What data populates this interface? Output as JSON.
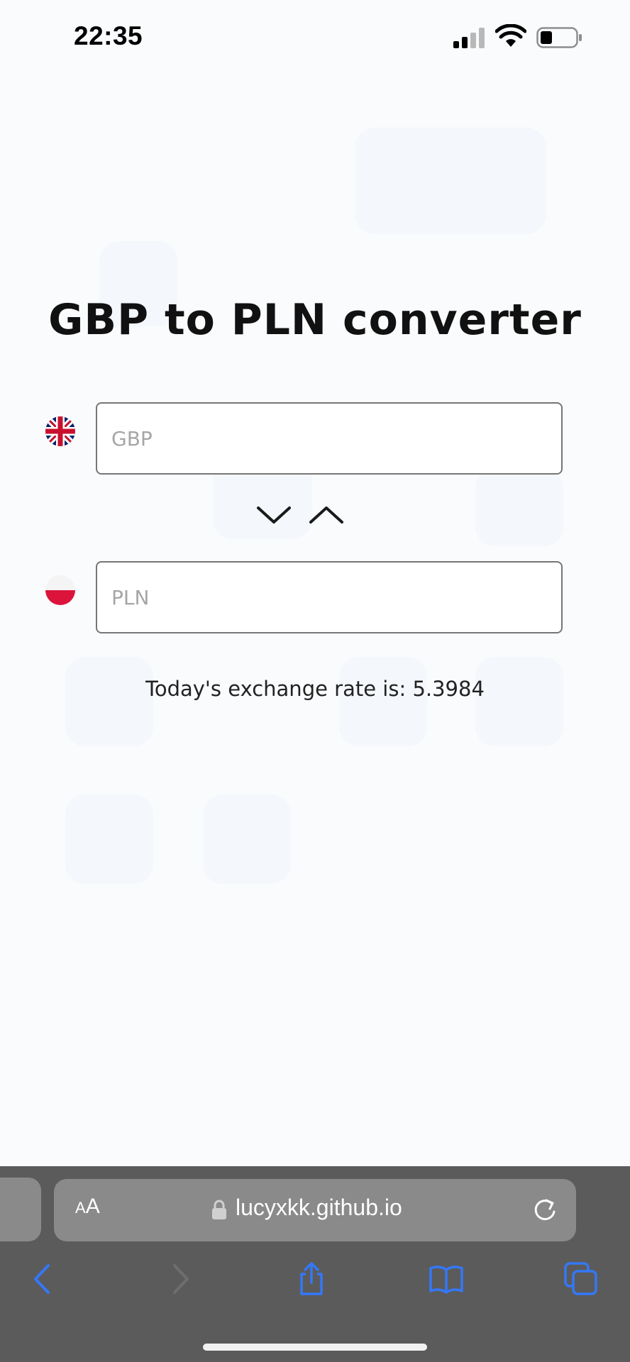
{
  "status_bar": {
    "time": "22:35",
    "icons": [
      "signal-icon",
      "wifi-icon",
      "battery-icon"
    ]
  },
  "converter": {
    "title": "GBP to PLN converter",
    "from": {
      "flag_icon": "uk-flag-icon",
      "value": "",
      "placeholder": "GBP"
    },
    "to": {
      "flag_icon": "poland-flag-icon",
      "value": "",
      "placeholder": "PLN"
    },
    "swap_icons": [
      "chevron-down-icon",
      "chevron-up-icon"
    ],
    "rate_text": "Today's exchange rate is: 5.3984"
  },
  "browser": {
    "text_size_small": "A",
    "text_size_large": "A",
    "url": "lucyxkk.github.io",
    "icons": [
      "lock-icon",
      "reload-icon",
      "back-icon",
      "forward-icon",
      "share-icon",
      "bookmarks-icon",
      "tabs-icon"
    ]
  },
  "colors": {
    "page_background": "#f9fbfd",
    "input_border": "#767676",
    "browser_chrome": "#5b5b5c",
    "address_bar": "#8a8a8b",
    "accent_blue": "#3478f6"
  }
}
